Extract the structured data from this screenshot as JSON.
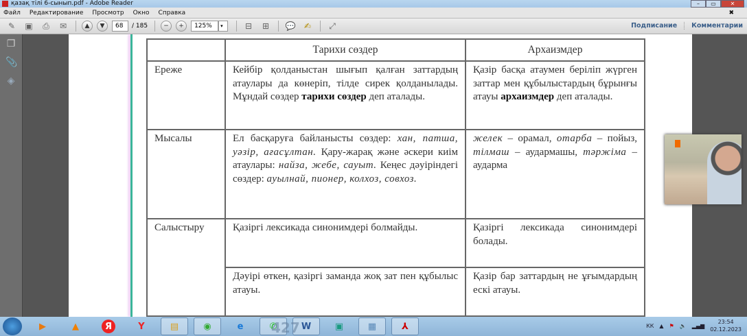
{
  "window": {
    "title": "қазақ тілі 6-сынып.pdf - Adobe Reader"
  },
  "menu": [
    "Файл",
    "Редактирование",
    "Просмотр",
    "Окно",
    "Справка"
  ],
  "toolbar": {
    "page_current": "68",
    "page_total": "/ 185",
    "zoom": "125%",
    "sign_label": "Подписание",
    "comments_label": "Комментарии"
  },
  "table": {
    "headers": [
      "",
      "Тарихи сөздер",
      "Архаизмдер"
    ],
    "rows": [
      {
        "label": "Ереже",
        "historic_pre": "Кейбір қолданыстан шығып қалған заттардың атаулары да көнеріп, тілде сирек қолданылады. Мұндай сөздер ",
        "historic_bold": "тарихи сөздер",
        "historic_post": " деп аталады.",
        "archaic_pre": "Қазір басқа атаумен беріліп жүрген заттар мен құбылыстардың бұрынғы атауы ",
        "archaic_bold": "архаизмдер",
        "archaic_post": " деп аталады."
      },
      {
        "label": "Мысалы",
        "historic": [
          {
            "t": "Ел басқаруға байланысты сөздер: "
          },
          {
            "i": "хан, патша, уәзір, ағасұлтан."
          },
          {
            "t": " Қару-жарақ және әскери киім атаулары: "
          },
          {
            "i": "найза, жебе, сауыт."
          },
          {
            "t": " Кеңес дәуіріндегі сөздер: "
          },
          {
            "i": "ауылнай, пионер, колхоз, совхоз."
          }
        ],
        "archaic": [
          {
            "i": "желек"
          },
          {
            "t": " – орамал, "
          },
          {
            "i": "отарба"
          },
          {
            "t": " – пойыз, "
          },
          {
            "i": "тілмаш"
          },
          {
            "t": " – аудармашы, "
          },
          {
            "i": "тәржіма"
          },
          {
            "t": " – аударма"
          }
        ]
      },
      {
        "label": "Салыстыру",
        "historic": "Қазіргі лексикада синонимдері болмайды.",
        "archaic": "Қазіргі лексикада синонимдері болады."
      },
      {
        "historic": "Дәуірі өткен, қазіргі заманда жоқ зат пен құбылыс атауы.",
        "archaic": "Қазір бар заттардың не ұғымдардың ескі атауы."
      }
    ]
  },
  "taskbar": {
    "lang": "КК",
    "time": "23:54",
    "date": "02.12.2023",
    "ghost_text": "427"
  }
}
